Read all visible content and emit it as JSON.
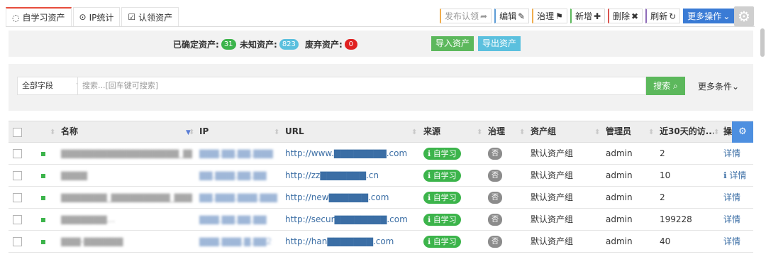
{
  "tabs": [
    {
      "icon": "◌",
      "label": "自学习资产",
      "active": true
    },
    {
      "icon": "⊙",
      "label": "IP统计",
      "active": false
    },
    {
      "icon": "☑",
      "label": "认领资产",
      "active": false
    }
  ],
  "toolbar": {
    "publish": "发布认领",
    "publish_icon": "➦",
    "edit": "编辑",
    "edit_icon": "✎",
    "govern": "治理",
    "govern_icon": "⚑",
    "add": "新增",
    "add_icon": "✚",
    "delete": "删除",
    "delete_icon": "✖",
    "refresh": "刷新",
    "refresh_icon": "↻",
    "more": "更多操作",
    "more_icon": "⌄"
  },
  "stats": {
    "confirmed_label": "已确定资产:",
    "confirmed_count": "31",
    "unknown_label": "未知资产:",
    "unknown_count": "823",
    "discarded_label": "废弃资产:",
    "discarded_count": "0",
    "import_label": "导入资产",
    "export_label": "导出资产"
  },
  "search": {
    "field": "全部字段",
    "placeholder": "搜索...[回车键可搜索]",
    "button": "搜索",
    "more_conditions": "更多条件⌄"
  },
  "table": {
    "headers": {
      "name": "名称",
      "ip": "IP",
      "url": "URL",
      "source": "来源",
      "govern": "治理",
      "group": "资产组",
      "admin": "管理员",
      "visits": "近30天的访...",
      "action": "操"
    },
    "rows": [
      {
        "name": "▇▇▇▇▇▇▇▇▇▇▇▇▇▇▇▇▇▇_▇▇_▇▇",
        "ip": "▇▇▇.▇▇.▇▇.▇▇▇",
        "url": "http://www.▇▇▇▇▇▇▇▇.com",
        "source": "自学习",
        "govern": "否",
        "group": "默认资产组",
        "admin": "admin",
        "visits": "2",
        "action": "详情"
      },
      {
        "name": "▇▇▇▇",
        "ip": "▇▇.▇▇▇.▇▇.▇▇",
        "url": "http://zz▇▇▇▇▇▇▇.cn",
        "source": "自学习",
        "govern": "否",
        "group": "默认资产组",
        "admin": "admin",
        "visits": "10",
        "action": "ℹ 详情"
      },
      {
        "name": "▇▇▇▇▇▇▇_▇▇▇▇▇▇▇▇▇_▇▇▇▇▇▇",
        "ip": "▇▇.▇▇▇.▇▇▇.▇▇▇",
        "url": "http://new▇▇▇▇▇▇.com",
        "source": "自学习",
        "govern": "否",
        "group": "默认资产组",
        "admin": "admin",
        "visits": "2",
        "action": "详情"
      },
      {
        "name": "▇▇▇▇▇▇▇...",
        "ip": "▇▇▇.▇▇.▇▇.▇▇",
        "url": "http://secur▇▇▇▇▇▇▇▇.com",
        "source": "自学习",
        "govern": "否",
        "group": "默认资产组",
        "admin": "admin",
        "visits": "199228",
        "action": "详情"
      },
      {
        "name": "▇▇▇-▇▇▇▇▇▇",
        "ip": "▇▇▇.▇▇▇.▇.▇▇2",
        "url": "http://han▇▇▇▇▇▇▇.com",
        "source": "自学习",
        "govern": "否",
        "group": "默认资产组",
        "admin": "admin",
        "visits": "40",
        "action": "详情"
      }
    ]
  }
}
